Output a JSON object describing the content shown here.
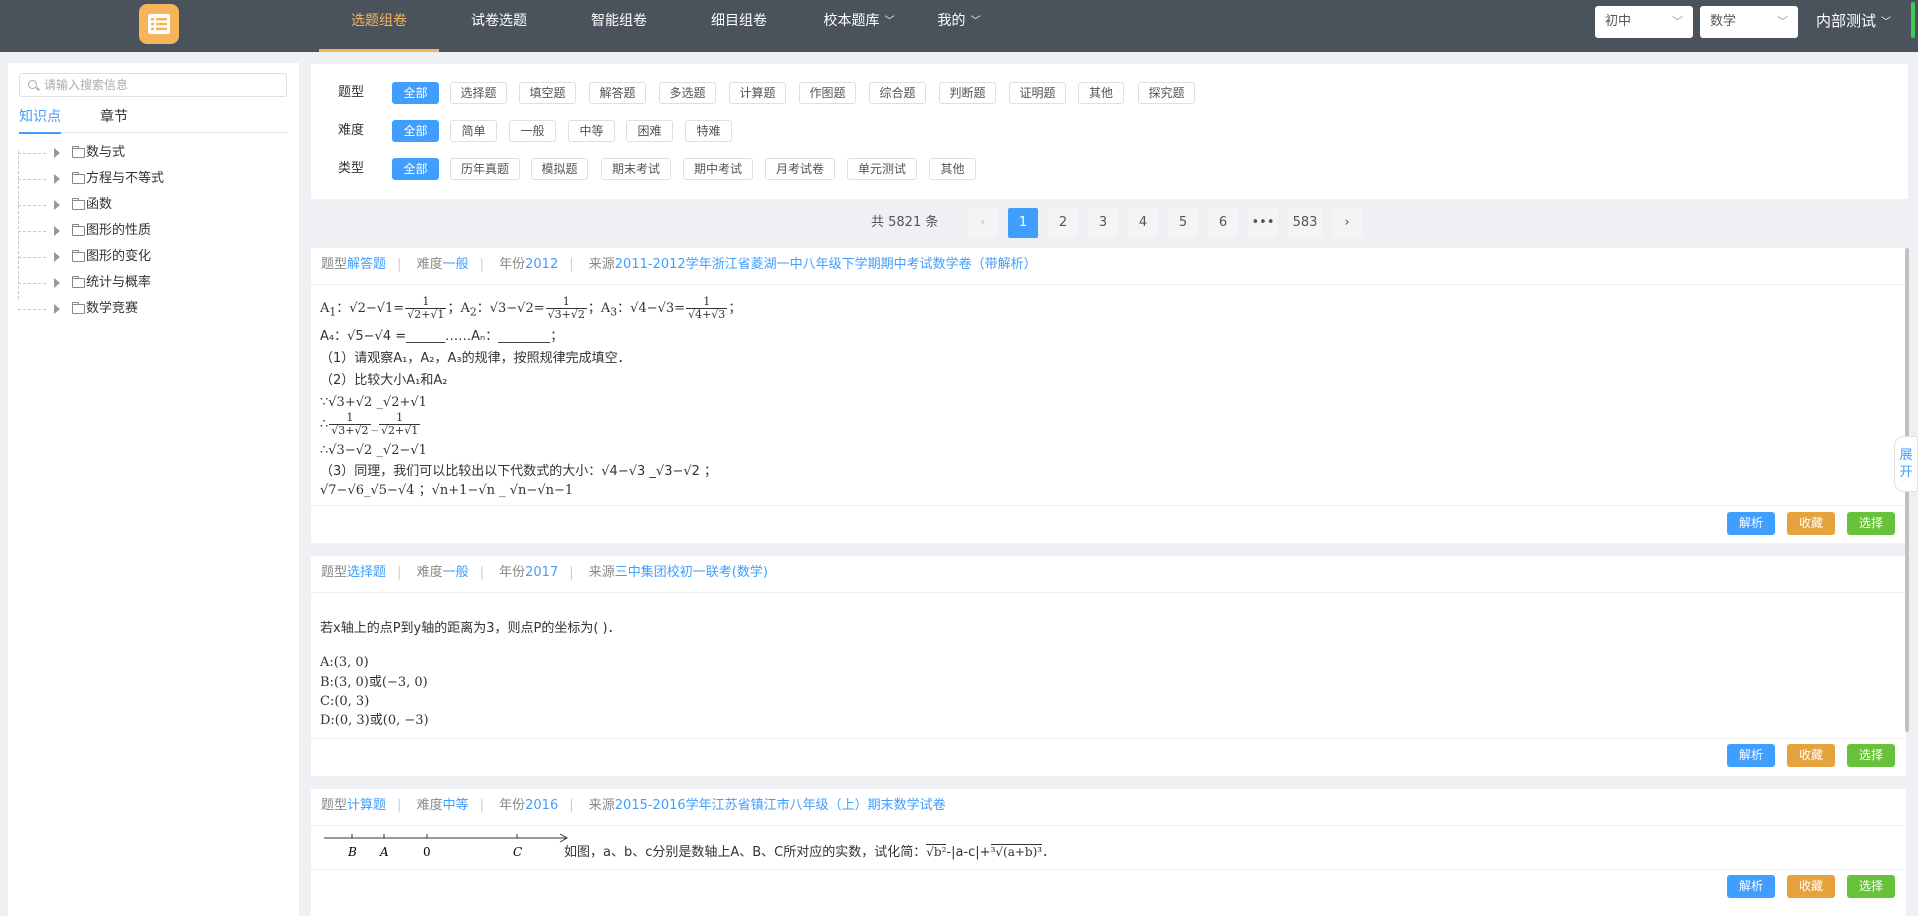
{
  "header": {
    "nav": [
      {
        "label": "选题组卷",
        "active": true,
        "dropdown": false
      },
      {
        "label": "试卷选题",
        "active": false,
        "dropdown": false
      },
      {
        "label": "智能组卷",
        "active": false,
        "dropdown": false
      },
      {
        "label": "细目组卷",
        "active": false,
        "dropdown": false
      },
      {
        "label": "校本题库",
        "active": false,
        "dropdown": true
      },
      {
        "label": "我的",
        "active": false,
        "dropdown": true
      }
    ],
    "grade_select": "初中",
    "subject_select": "数学",
    "user": "内部测试"
  },
  "sidebar": {
    "search_placeholder": "请输入搜索信息",
    "tabs": [
      "知识点",
      "章节"
    ],
    "tree": [
      "数与式",
      "方程与不等式",
      "函数",
      "图形的性质",
      "图形的变化",
      "统计与概率",
      "数学竞赛"
    ]
  },
  "filters": [
    {
      "label": "题型",
      "options": [
        "全部",
        "选择题",
        "填空题",
        "解答题",
        "多选题",
        "计算题",
        "作图题",
        "综合题",
        "判断题",
        "证明题",
        "其他",
        "探究题"
      ]
    },
    {
      "label": "难度",
      "options": [
        "全部",
        "简单",
        "一般",
        "中等",
        "困难",
        "特难"
      ]
    },
    {
      "label": "类型",
      "options": [
        "全部",
        "历年真题",
        "模拟题",
        "期末考试",
        "期中考试",
        "月考试卷",
        "单元测试",
        "其他"
      ]
    }
  ],
  "pagination": {
    "total": "共 5821 条",
    "prev": "‹",
    "next": "›",
    "pages": [
      "1",
      "2",
      "3",
      "4",
      "5",
      "6",
      "•••",
      "583"
    ],
    "current": "1"
  },
  "meta_labels": {
    "type": "题型",
    "difficulty": "难度",
    "year": "年份",
    "source": "来源"
  },
  "actions": {
    "analysis": "解析",
    "favorite": "收藏",
    "select": "选择"
  },
  "questions": [
    {
      "type": "解答题",
      "difficulty": "一般",
      "year": "2012",
      "source": "2011-2012学年浙江省菱湖一中八年级下学期期中考试数学卷（带解析）",
      "lines": {
        "l1a": "A",
        "l1b": "1",
        "l1c": "：",
        "l1expr1": "√2−√1=",
        "l1frac1n": "1",
        "l1frac1d": "√2+√1",
        "l1d": "；A",
        "l1e": "2",
        "l1f": "：",
        "l1expr2": "√3−√2=",
        "l1frac2n": "1",
        "l1frac2d": "√3+√2",
        "l1g": "；A",
        "l1h": "3",
        "l1i": "：",
        "l1expr3": "√4−√3=",
        "l1frac3n": "1",
        "l1frac3d": "√4+√3",
        "l1j": "；",
        "l2": "A₄：√5−√4 =______……Aₙ：________；",
        "l3": "（1）请观察A₁，A₂，A₃的规律，按照规律完成填空．",
        "l4": "（2）比较大小A₁和A₂",
        "l5": "∵√3+√2 _√2+√1",
        "l6a": "∴",
        "l6f1n": "1",
        "l6f1d": "√3+√2",
        "l6b": "_",
        "l6f2n": "1",
        "l6f2d": "√2+√1",
        "l7": "∴√3−√2 _√2−√1",
        "l8": "（3）同理，我们可以比较出以下代数式的大小：√4−√3 _√3−√2 ；",
        "l9": "√7−√6_√5−√4 ；√n+1−√n _ √n−√n−1"
      }
    },
    {
      "type": "选择题",
      "difficulty": "一般",
      "year": "2017",
      "source": "三中集团校初一联考(数学)",
      "stem": "若x轴上的点P到y轴的距离为3，则点P的坐标为(    )．",
      "options": [
        "A:(3, 0)",
        "B:(3, 0)或(−3, 0)",
        "C:(0, 3)",
        "D:(0, 3)或(0, −3)"
      ]
    },
    {
      "type": "计算题",
      "difficulty": "中等",
      "year": "2016",
      "source": "2015-2016学年江苏省镇江市八年级（上）期末数学试卷",
      "number_line": [
        "B",
        "A",
        "0",
        "C"
      ],
      "stem_a": "如图，a、b、c分别是数轴上A、B、C所对应的实数，试化简：",
      "stem_b": "√b²",
      "stem_c": "-|a-c|+",
      "stem_d": "³√(a+b)³",
      "stem_e": "．"
    }
  ],
  "side_expand": "展开"
}
